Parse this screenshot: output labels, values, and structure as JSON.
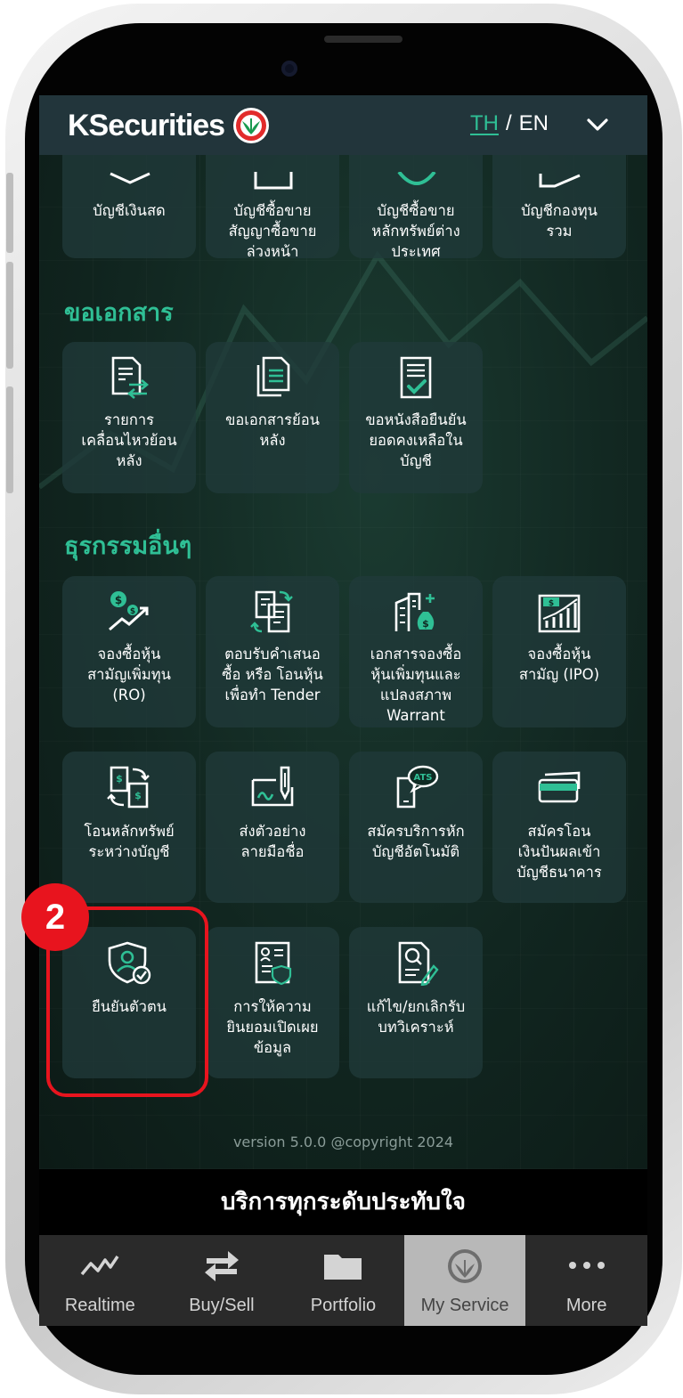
{
  "header": {
    "brand": "KSecurities",
    "lang_active": "TH",
    "lang_sep": "/",
    "lang_other": "EN"
  },
  "accounts": {
    "items": [
      {
        "label": "บัญชีเงินสด",
        "icon": "cash-account-icon"
      },
      {
        "label": "บัญชีซื้อขาย\nสัญญาซื้อขาย\nล่วงหน้า",
        "icon": "derivatives-account-icon"
      },
      {
        "label": "บัญชีซื้อขาย\nหลักทรัพย์ต่าง\nประเทศ",
        "icon": "globe-icon"
      },
      {
        "label": "บัญชีกองทุน\nรวม",
        "icon": "fund-account-icon"
      }
    ]
  },
  "documents": {
    "title": "ขอเอกสาร",
    "items": [
      {
        "label": "รายการ\nเคลื่อนไหวย้อน\nหลัง",
        "icon": "statement-transfer-icon"
      },
      {
        "label": "ขอเอกสารย้อน\nหลัง",
        "icon": "documents-icon"
      },
      {
        "label": "ขอหนังสือยืนยัน\nยอดคงเหลือใน\nบัญชี",
        "icon": "document-check-icon"
      }
    ]
  },
  "other": {
    "title": "ธุรกรรมอื่นๆ",
    "items": [
      {
        "label": "จองซื้อหุ้น\nสามัญเพิ่มทุน\n(RO)",
        "icon": "stock-growth-icon"
      },
      {
        "label": "ตอบรับคำเสนอ\nซื้อ หรือ โอนหุ้น\nเพื่อทำ Tender",
        "icon": "tender-transfer-icon"
      },
      {
        "label": "เอกสารจองซื้อ\nหุ้นเพิ่มทุนและ\nแปลงสภาพ\nWarrant",
        "icon": "building-moneybag-icon"
      },
      {
        "label": "จองซื้อหุ้น\nสามัญ (IPO)",
        "icon": "ipo-chart-icon"
      },
      {
        "label": "โอนหลักทรัพย์\nระหว่างบัญชี",
        "icon": "securities-transfer-icon"
      },
      {
        "label": "ส่งตัวอย่าง\nลายมือชื่อ",
        "icon": "signature-pen-icon"
      },
      {
        "label": "สมัครบริการหัก\nบัญชีอัตโนมัติ",
        "icon": "ats-phone-icon"
      },
      {
        "label": "สมัครโอน\nเงินปันผลเข้า\nบัญชีธนาคาร",
        "icon": "bank-card-icon"
      },
      {
        "label": "ยืนยันตัวตน",
        "icon": "identity-shield-icon"
      },
      {
        "label": "การให้ความ\nยินยอมเปิดเผย\nข้อมูล",
        "icon": "consent-document-icon"
      },
      {
        "label": "แก้ไข/ยกเลิกรับ\nบทวิเคราะห์",
        "icon": "research-edit-icon"
      }
    ]
  },
  "version": "version 5.0.0 @copyright 2024",
  "step_badge": "2",
  "banner": "บริการทุกระดับประทับใจ",
  "tabbar": {
    "tabs": [
      {
        "label": "Realtime",
        "icon": "realtime-chart-icon"
      },
      {
        "label": "Buy/Sell",
        "icon": "buy-sell-arrows-icon"
      },
      {
        "label": "Portfolio",
        "icon": "folder-icon"
      },
      {
        "label": "My Service",
        "icon": "kbank-logo-icon",
        "active": true
      },
      {
        "label": "More",
        "icon": "more-dots-icon"
      }
    ]
  },
  "colors": {
    "accent": "#2fbf95",
    "header_bg": "#22353b",
    "tile_bg": "#203a3a",
    "highlight": "#e8141e"
  }
}
